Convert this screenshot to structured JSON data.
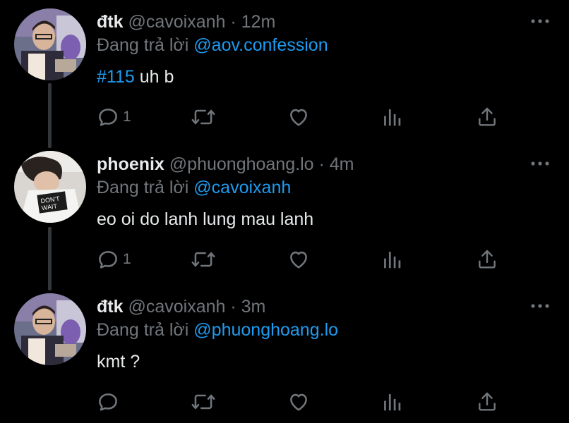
{
  "tweets": [
    {
      "display_name": "đtk",
      "handle": "@cavoixanh",
      "separator": "·",
      "time": "12m",
      "reply_prefix": "Đang trả lời",
      "reply_to": "@aov.confession",
      "hashtag": "#115",
      "text": " uh b",
      "reply_count": "1",
      "avatar_icon": "person-photo-avatar"
    },
    {
      "display_name": "phoenix",
      "handle": "@phuonghoang.lo",
      "separator": "·",
      "time": "4m",
      "reply_prefix": "Đang trả lời",
      "reply_to": "@cavoixanh",
      "hashtag": "",
      "text": "eo oi do lanh lung mau lanh",
      "reply_count": "1",
      "avatar_icon": "person-photo-avatar"
    },
    {
      "display_name": "đtk",
      "handle": "@cavoixanh",
      "separator": "·",
      "time": "3m",
      "reply_prefix": "Đang trả lời",
      "reply_to": "@phuonghoang.lo",
      "hashtag": "",
      "text": "kmt ?",
      "reply_count": "",
      "avatar_icon": "person-photo-avatar"
    }
  ],
  "icons": {
    "reply": "reply-icon",
    "retweet": "retweet-icon",
    "like": "heart-icon",
    "analytics": "analytics-icon",
    "share": "share-icon",
    "more": "more-icon"
  },
  "colors": {
    "background": "#000000",
    "text": "#e7e9ea",
    "secondary": "#71767b",
    "accent": "#1d9bf0",
    "thread_line": "#333639"
  }
}
